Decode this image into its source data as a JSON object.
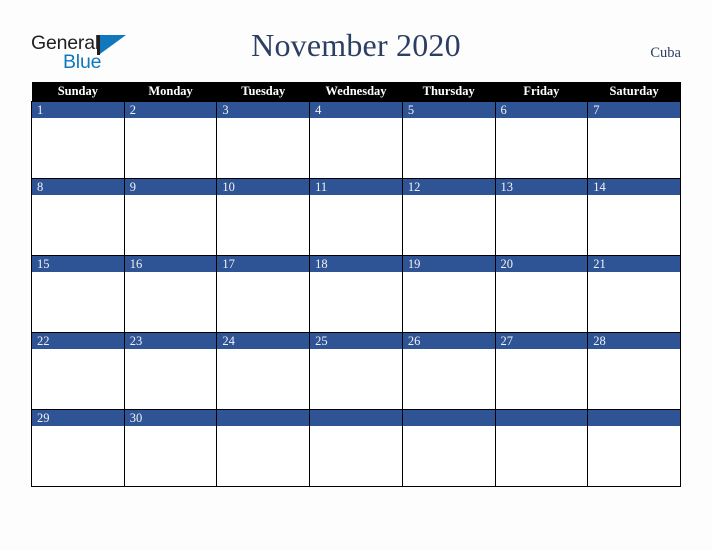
{
  "brand": {
    "name_part1": "General",
    "name_part2": "Blue",
    "triangle_icon": "triangle-icon",
    "colors": {
      "part1": "#231f20",
      "part2": "#1278be",
      "triangle": "#1278be"
    }
  },
  "header": {
    "title": "November 2020",
    "month": "November",
    "year": "2020",
    "locale": "Cuba"
  },
  "theme": {
    "page_background": "#fdfdfd",
    "weekday_header_background": "#000000",
    "weekday_header_text": "#ffffff",
    "day_band_background": "#2f5496",
    "day_band_text": "#f2f2f2",
    "cell_background": "#ffffff",
    "cell_border": "#000000",
    "title_color": "#2c3f63"
  },
  "calendar": {
    "weekdays": [
      "Sunday",
      "Monday",
      "Tuesday",
      "Wednesday",
      "Thursday",
      "Friday",
      "Saturday"
    ],
    "weeks": [
      [
        {
          "day": "1",
          "empty": false
        },
        {
          "day": "2",
          "empty": false
        },
        {
          "day": "3",
          "empty": false
        },
        {
          "day": "4",
          "empty": false
        },
        {
          "day": "5",
          "empty": false
        },
        {
          "day": "6",
          "empty": false
        },
        {
          "day": "7",
          "empty": false
        }
      ],
      [
        {
          "day": "8",
          "empty": false
        },
        {
          "day": "9",
          "empty": false
        },
        {
          "day": "10",
          "empty": false
        },
        {
          "day": "11",
          "empty": false
        },
        {
          "day": "12",
          "empty": false
        },
        {
          "day": "13",
          "empty": false
        },
        {
          "day": "14",
          "empty": false
        }
      ],
      [
        {
          "day": "15",
          "empty": false
        },
        {
          "day": "16",
          "empty": false
        },
        {
          "day": "17",
          "empty": false
        },
        {
          "day": "18",
          "empty": false
        },
        {
          "day": "19",
          "empty": false
        },
        {
          "day": "20",
          "empty": false
        },
        {
          "day": "21",
          "empty": false
        }
      ],
      [
        {
          "day": "22",
          "empty": false
        },
        {
          "day": "23",
          "empty": false
        },
        {
          "day": "24",
          "empty": false
        },
        {
          "day": "25",
          "empty": false
        },
        {
          "day": "26",
          "empty": false
        },
        {
          "day": "27",
          "empty": false
        },
        {
          "day": "28",
          "empty": false
        }
      ],
      [
        {
          "day": "29",
          "empty": false
        },
        {
          "day": "30",
          "empty": false
        },
        {
          "day": "",
          "empty": true
        },
        {
          "day": "",
          "empty": true
        },
        {
          "day": "",
          "empty": true
        },
        {
          "day": "",
          "empty": true
        },
        {
          "day": "",
          "empty": true
        }
      ]
    ]
  }
}
